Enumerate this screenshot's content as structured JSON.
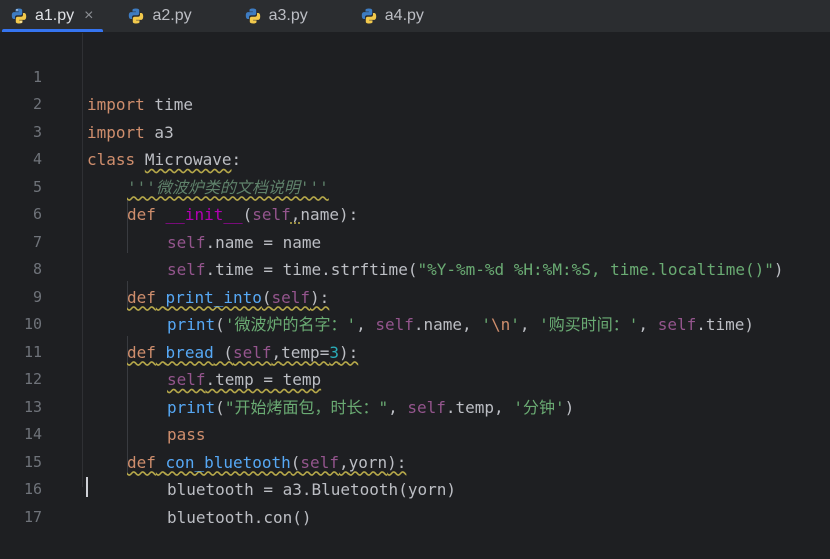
{
  "tabs": [
    {
      "label": "a1.py",
      "active": true,
      "icon": "python-icon"
    },
    {
      "label": "a2.py",
      "active": false,
      "icon": "python-icon"
    },
    {
      "label": "a3.py",
      "active": false,
      "icon": "python-icon"
    },
    {
      "label": "a4.py",
      "active": false,
      "icon": "python-icon"
    }
  ],
  "close_glyph": "×",
  "line_numbers": [
    "1",
    "2",
    "3",
    "4",
    "5",
    "6",
    "7",
    "8",
    "9",
    "10",
    "11",
    "12",
    "13",
    "14",
    "15",
    "16",
    "17"
  ],
  "code": {
    "l1": {
      "kw": "import",
      "rest": " time"
    },
    "l2": {
      "kw": "import",
      "rest": " a3"
    },
    "l3": {
      "kw": "class",
      "name": "Microwave",
      "colon": ":"
    },
    "l4": {
      "doc": "'''微波炉类的文档说明'''"
    },
    "l5": {
      "kw": "def",
      "fn": "__init__",
      "open": "(",
      "self": "self",
      "comma": ",",
      "params": "name",
      "close": "):"
    },
    "l6": {
      "self": "self",
      "rest": ".name = name"
    },
    "l7": {
      "self": "self",
      "rest": ".time = time.strftime(",
      "str": "\"%Y-%m-%d %H:%M:%S, time.localtime()\"",
      "close": ")"
    },
    "l8": {
      "kw": "def",
      "fn": "print_into",
      "open": "(",
      "self": "self",
      "close": "):"
    },
    "l9": {
      "print": "print",
      "open": "(",
      "s1": "'微波炉的名字：'",
      "c1": ", ",
      "self1": "self",
      "r1": ".name, ",
      "q1": "'",
      "esc": "\\n",
      "q2": "'",
      "c2": ", ",
      "s2": "'购买时间：'",
      "c3": ", ",
      "self2": "self",
      "r2": ".time)"
    },
    "l10": {
      "kw": "def",
      "fn": "bread",
      "sp": " (",
      "self": "self",
      "comma": ",",
      "param": "temp=",
      "num": "3",
      "close": "):"
    },
    "l11": {
      "self": "self",
      "rest": ".temp = temp"
    },
    "l12": {
      "print": "print",
      "open": "(",
      "s1": "\"开始烤面包，时长：\"",
      "c1": ", ",
      "self": "self",
      "r1": ".temp, ",
      "s2": "'分钟'",
      "close": ")"
    },
    "l13": {
      "kw": "pass"
    },
    "l14": {
      "kw": "def",
      "fn": "con_bluetooth",
      "open": "(",
      "self": "self",
      "comma": ",",
      "params": "yorn",
      "close": "):"
    },
    "l15": {
      "rest": "bluetooth = a3.Bluetooth(yorn)"
    },
    "l16": {
      "rest": "bluetooth.con()"
    }
  }
}
